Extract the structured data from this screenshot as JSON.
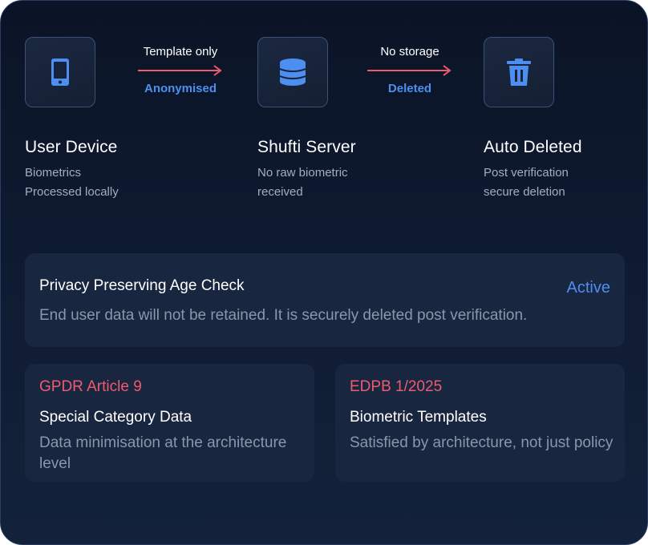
{
  "flow": {
    "nodes": [
      {
        "icon": "mobile-phone-icon",
        "title": "User Device",
        "sub_line1": "Biometrics",
        "sub_line2": "Processed locally"
      },
      {
        "icon": "database-icon",
        "title": "Shufti Server",
        "sub_line1": "No raw biometric",
        "sub_line2": "received"
      },
      {
        "icon": "trash-icon",
        "title": "Auto Deleted",
        "sub_line1": "Post verification",
        "sub_line2": "secure deletion"
      }
    ],
    "transfers": [
      {
        "top_label": "Template only",
        "bottom_label": "Anonymised"
      },
      {
        "top_label": "No storage",
        "bottom_label": "Deleted"
      }
    ]
  },
  "privacy_check": {
    "title": "Privacy Preserving Age Check",
    "status": "Active",
    "description": "End user data will not be retained. It is securely deleted post verification."
  },
  "regulations": [
    {
      "tag": "GPDR Article 9",
      "title": "Special Category Data",
      "description": "Data minimisation at the architecture level"
    },
    {
      "tag": "EDPB 1/2025",
      "title": "Biometric Templates",
      "description": "Satisfied by architecture, not just policy"
    }
  ],
  "colors": {
    "accent_blue": "#4d8ff0",
    "arrow_red": "#ee5b6e",
    "tag_red": "#ee5b6e",
    "card_bg": "#0e1a30",
    "panel_bg": "#18263f",
    "muted_text": "#8a97ab"
  }
}
